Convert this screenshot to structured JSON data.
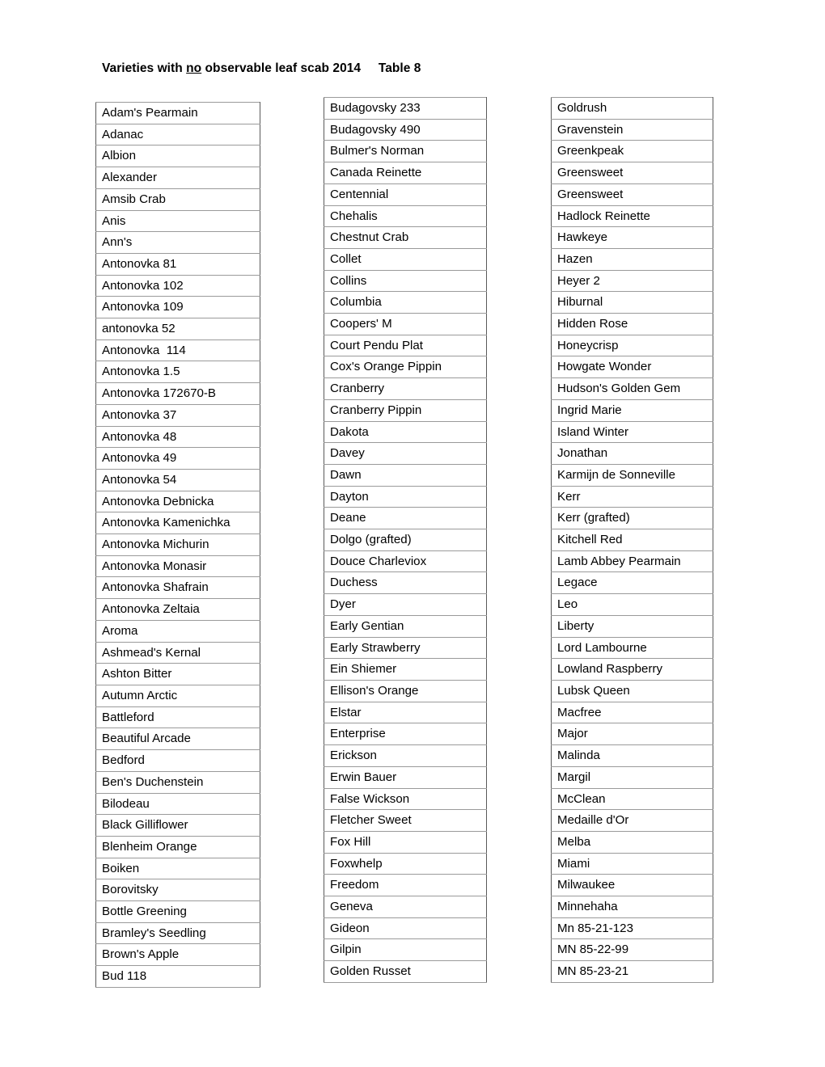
{
  "title": {
    "before": "Varieties with ",
    "underlined": "no",
    "after": " observable leaf scab 2014     Table 8"
  },
  "tables": {
    "column1": [
      "Adam's Pearmain",
      "Adanac",
      "Albion",
      "Alexander",
      "Amsib Crab",
      "Anis",
      "Ann's",
      "Antonovka 81",
      "Antonovka 102",
      "Antonovka 109",
      "antonovka 52",
      "Antonovka  114",
      "Antonovka 1.5",
      "Antonovka 172670-B",
      "Antonovka 37",
      "Antonovka 48",
      "Antonovka 49",
      "Antonovka 54",
      "Antonovka Debnicka",
      "Antonovka Kamenichka",
      "Antonovka Michurin",
      "Antonovka Monasir",
      "Antonovka Shafrain",
      "Antonovka Zeltaia",
      "Aroma",
      "Ashmead's Kernal",
      "Ashton Bitter",
      "Autumn Arctic",
      "Battleford",
      "Beautiful Arcade",
      "Bedford",
      "Ben's Duchenstein",
      "Bilodeau",
      "Black Gilliflower",
      "Blenheim Orange",
      "Boiken",
      "Borovitsky",
      "Bottle Greening",
      "Bramley's Seedling",
      "Brown's Apple",
      "Bud 118"
    ],
    "column2": [
      "Budagovsky 233",
      "Budagovsky 490",
      "Bulmer's Norman",
      "Canada Reinette",
      "Centennial",
      "Chehalis",
      "Chestnut Crab",
      "Collet",
      "Collins",
      "Columbia",
      "Coopers' M",
      "Court Pendu Plat",
      "Cox's Orange Pippin",
      "Cranberry",
      "Cranberry Pippin",
      "Dakota",
      "Davey",
      "Dawn",
      "Dayton",
      "Deane",
      "Dolgo (grafted)",
      "Douce Charleviox",
      "Duchess",
      "Dyer",
      "Early Gentian",
      "Early Strawberry",
      "Ein Shiemer",
      "Ellison's Orange",
      "Elstar",
      "Enterprise",
      "Erickson",
      "Erwin Bauer",
      "False Wickson",
      "Fletcher Sweet",
      "Fox Hill",
      "Foxwhelp",
      "Freedom",
      "Geneva",
      "Gideon",
      "Gilpin",
      "Golden Russet"
    ],
    "column3": [
      "Goldrush",
      "Gravenstein",
      "Greenkpeak",
      "Greensweet",
      "Greensweet",
      "Hadlock Reinette",
      "Hawkeye",
      "Hazen",
      "Heyer 2",
      "Hiburnal",
      "Hidden Rose",
      "Honeycrisp",
      "Howgate Wonder",
      "Hudson's Golden Gem",
      "Ingrid Marie",
      "Island Winter",
      "Jonathan",
      "Karmijn de Sonneville",
      "Kerr",
      "Kerr (grafted)",
      "Kitchell Red",
      "Lamb Abbey Pearmain",
      "Legace",
      "Leo",
      "Liberty",
      "Lord Lambourne",
      "Lowland Raspberry",
      "Lubsk Queen",
      "Macfree",
      "Major",
      "Malinda",
      "Margil",
      "McClean",
      "Medaille d'Or",
      "Melba",
      "Miami",
      "Milwaukee",
      "Minnehaha",
      "Mn 85-21-123",
      "MN 85-22-99",
      "MN 85-23-21"
    ]
  }
}
